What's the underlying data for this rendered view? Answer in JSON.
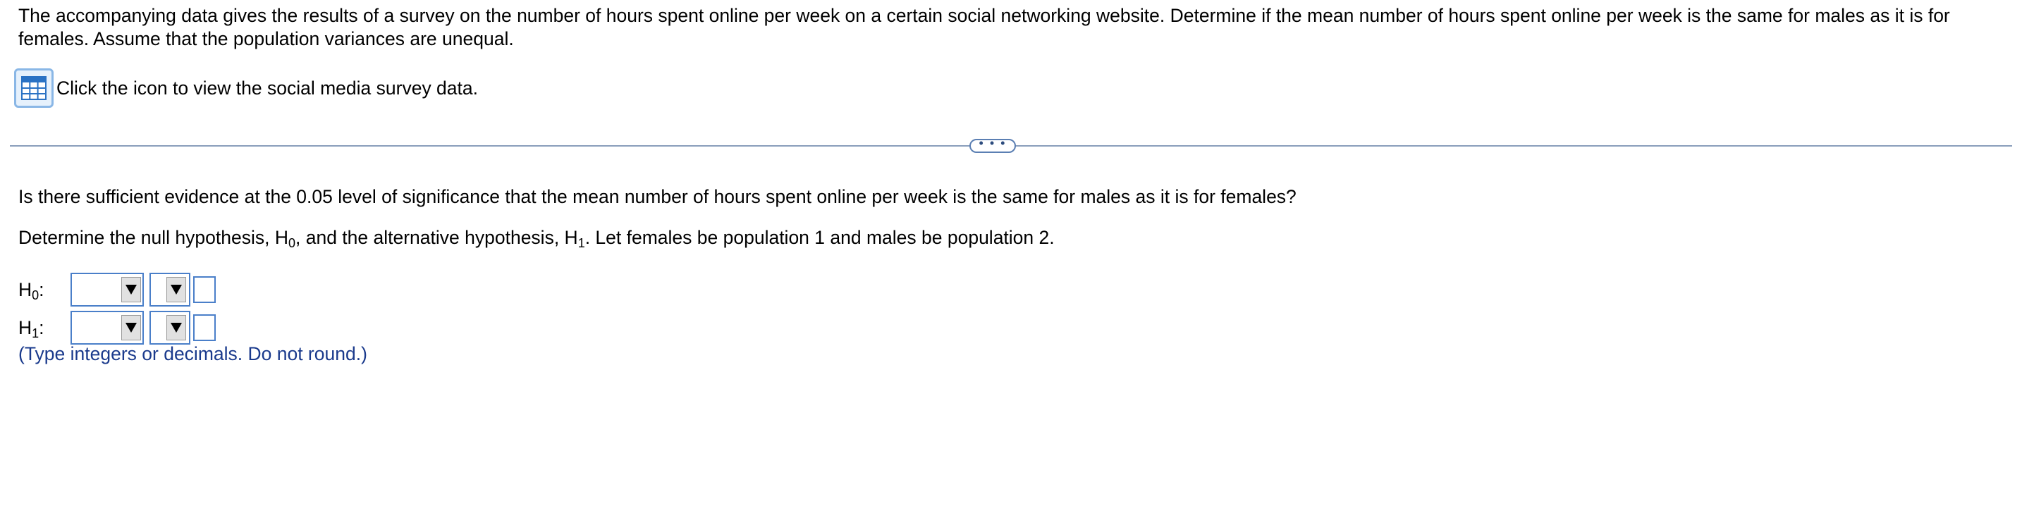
{
  "problem": {
    "prompt": "The accompanying data gives the results of a survey on the number of hours spent online per week on a certain social networking website. Determine if the mean number of hours spent online per week is the same for males as it is for females. Assume that the population variances are unequal.",
    "data_link_text": "Click the icon to view the social media survey data."
  },
  "divider": {
    "toggle_label": "• • •"
  },
  "question": {
    "text": "Is there sufficient evidence at the 0.05 level of significance that the mean number of hours spent online per week is the same for males as it is for females?",
    "instruction_part1": "Determine the null hypothesis, H",
    "instruction_sub0": "0",
    "instruction_part2": ", and the alternative hypothesis, H",
    "instruction_sub1": "1",
    "instruction_part3": ". Let females be population 1 and males be population 2."
  },
  "hypotheses": {
    "h0": {
      "letter": "H",
      "sub": "0",
      "suffix": ":",
      "parameter_selected": "",
      "operator_selected": "",
      "value": ""
    },
    "h1": {
      "letter": "H",
      "sub": "1",
      "suffix": ":",
      "parameter_selected": "",
      "operator_selected": "",
      "value": ""
    },
    "note": "(Type integers or decimals. Do not round.)"
  },
  "icons": {
    "data_table": "table-grid-icon",
    "dropdown": "triangle-down-icon"
  },
  "colors": {
    "icon_blue": "#2a72c4",
    "input_border": "#4a7fc9",
    "note_text": "#1a3a8c",
    "divider": "#8a9ebb"
  }
}
